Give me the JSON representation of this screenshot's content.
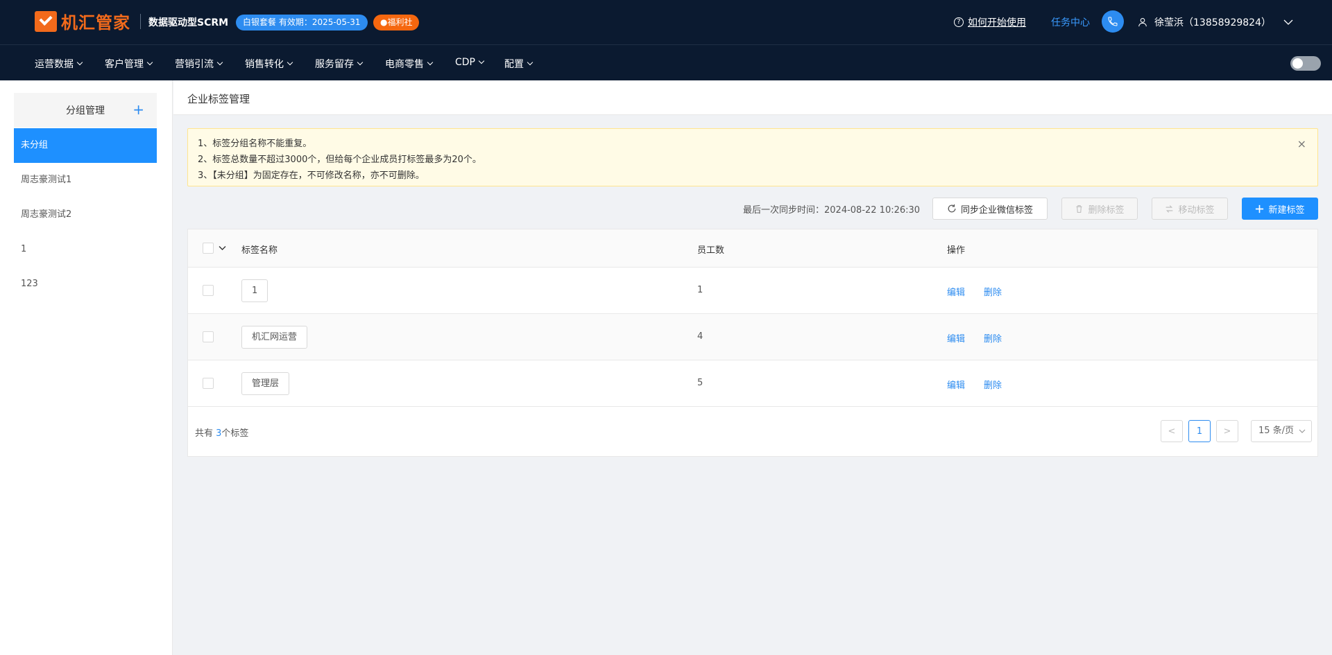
{
  "header": {
    "logo_text": "机汇管家",
    "product_name": "数据驱动型SCRM",
    "plan_badge": "白银套餐 有效期：2025-05-31",
    "welfare_badge": "●福利社",
    "help_icon": "question-circle",
    "help_link": "如何开始使用",
    "task_center": "任务中心",
    "user_name": "徐莹浜（13858929824）"
  },
  "nav": {
    "items": [
      "运营数据",
      "客户管理",
      "营销引流",
      "销售转化",
      "服务留存",
      "电商零售",
      "CDP",
      "配置"
    ]
  },
  "sidebar": {
    "title": "分组管理",
    "add_label": "+",
    "items": [
      "未分组",
      "周志豪测试1",
      "周志豪测试2",
      "1",
      "123"
    ]
  },
  "breadcrumb": "企业标签管理",
  "notice": {
    "lines": [
      "1、标签分组名称不能重复。",
      "2、标签总数量不超过3000个，但给每个企业成员打标签最多为20个。",
      "3、【未分组】为固定存在，不可修改名称，亦不可删除。"
    ],
    "close": "×"
  },
  "toolbar": {
    "sync_time": "最后一次同步时间：2024-08-22 10:26:30",
    "sync_button": "同步企业微信标签",
    "delete_button": "删除标签",
    "move_button": "移动标签",
    "new_button": "新建标签"
  },
  "table": {
    "headers": [
      "标签名称",
      "员工数",
      "操作"
    ],
    "rows": [
      {
        "name": "1",
        "count": "1",
        "edit": "编辑",
        "delete": "删除"
      },
      {
        "name": "机汇网运营",
        "count": "4",
        "edit": "编辑",
        "delete": "删除"
      },
      {
        "name": "管理层",
        "count": "5",
        "edit": "编辑",
        "delete": "删除"
      }
    ]
  },
  "footer": {
    "total_prefix": "共有 ",
    "total_count": "3",
    "total_suffix": "个标签",
    "prev": "<",
    "current_page": "1",
    "next": ">",
    "page_size": "15 条/页"
  },
  "colors": {
    "topbar_bg": "#0b1a30",
    "primary": "#1e90ff",
    "brand_orange": "#f26a1b"
  }
}
